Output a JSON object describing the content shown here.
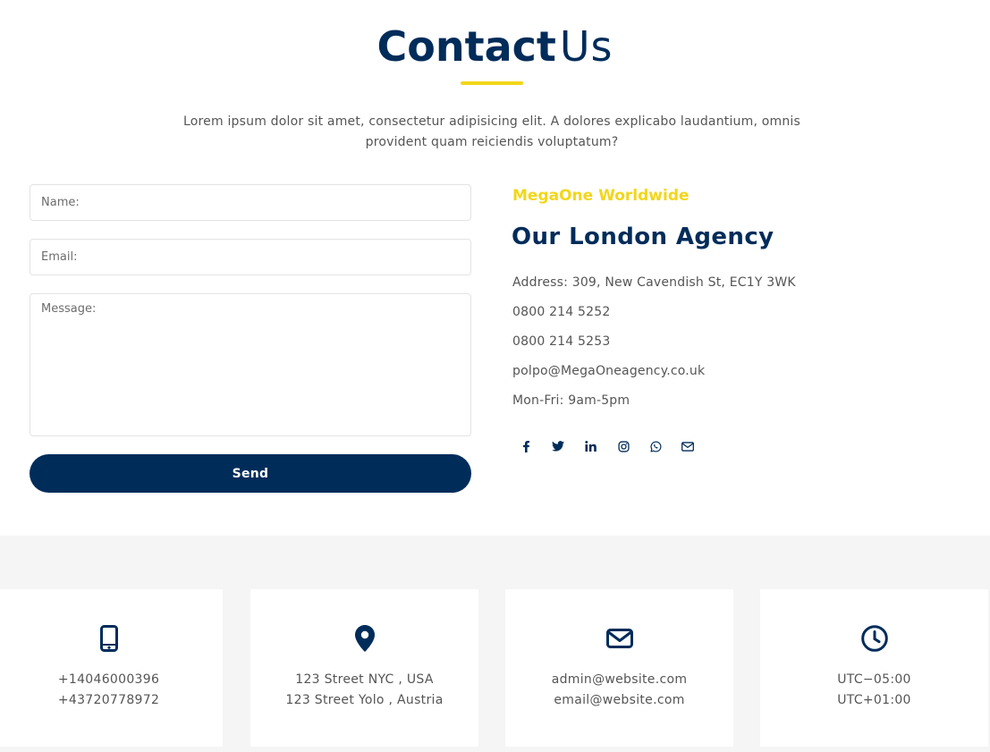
{
  "header": {
    "title_bold": "Contact",
    "title_light": "Us",
    "intro": "Lorem ipsum dolor sit amet, consectetur adipisicing elit. A dolores explicabo laudantium, omnis provident quam reiciendis voluptatum?"
  },
  "form": {
    "name_placeholder": "Name:",
    "email_placeholder": "Email:",
    "message_placeholder": "Message:",
    "send_label": "Send"
  },
  "agency": {
    "kicker": "MegaOne Worldwide",
    "title": "Our London Agency",
    "address": "Address: 309, New Cavendish St, EC1Y 3WK",
    "phone1": "0800 214 5252",
    "phone2": "0800 214 5253",
    "email": "polpo@MegaOneagency.co.uk",
    "hours": "Mon-Fri: 9am-5pm",
    "social_icons": [
      "facebook-icon",
      "twitter-icon",
      "linkedin-icon",
      "instagram-icon",
      "whatsapp-icon",
      "envelope-icon"
    ]
  },
  "cards": [
    {
      "icon": "mobile-phone-icon",
      "line1": "+14046000396",
      "line2": "+43720778972"
    },
    {
      "icon": "map-marker-icon",
      "line1": "123 Street NYC , USA",
      "line2": "123 Street Yolo , Austria"
    },
    {
      "icon": "envelope-icon",
      "line1": "admin@website.com",
      "line2": "email@website.com"
    },
    {
      "icon": "clock-icon",
      "line1": "UTC−05:00",
      "line2": "UTC+01:00"
    }
  ],
  "colors": {
    "navy": "#002c5a",
    "accent_yellow": "#f2d61a",
    "text_gray": "#555555",
    "bottom_bg": "#f5f5f5"
  }
}
